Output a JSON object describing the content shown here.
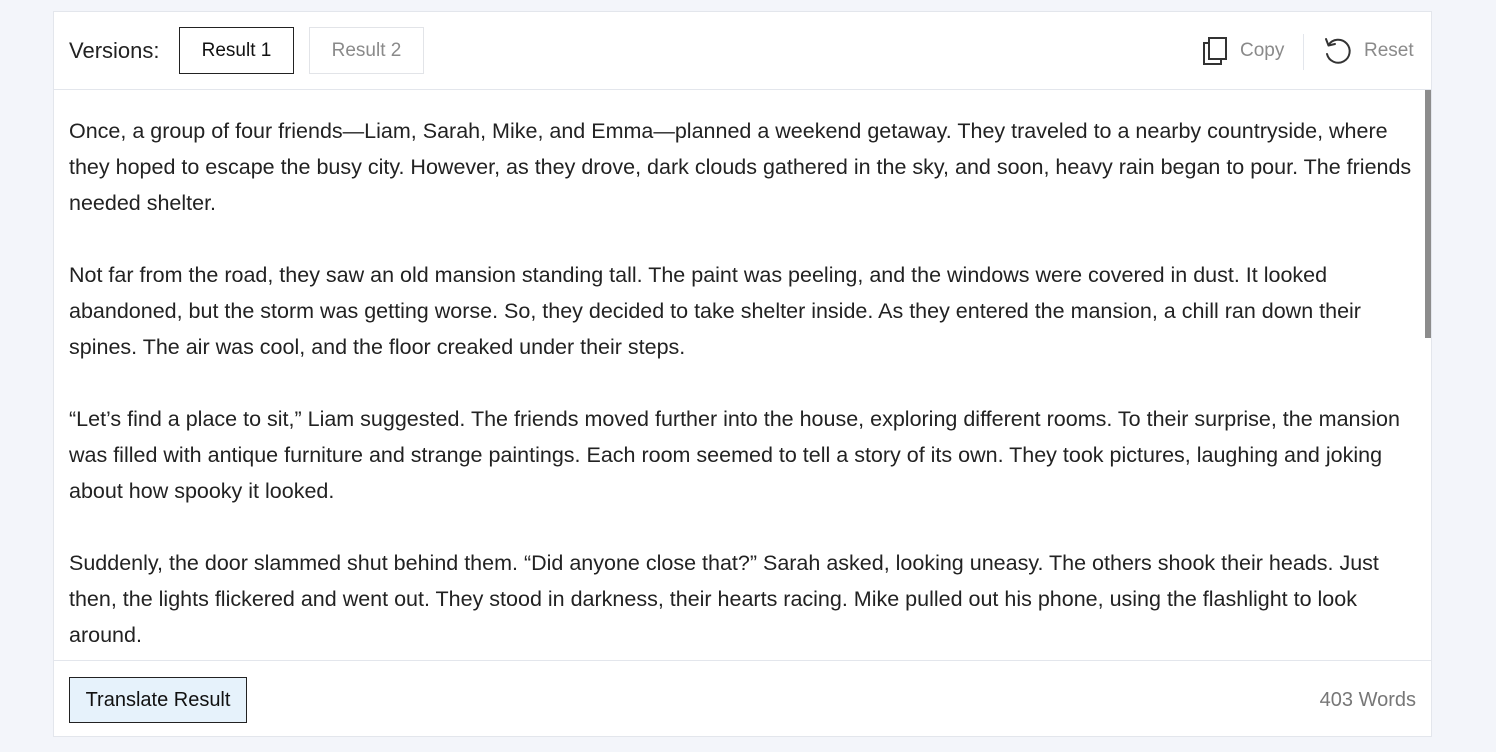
{
  "toolbar": {
    "versions_label": "Versions:",
    "tabs": [
      {
        "label": "Result 1",
        "active": true
      },
      {
        "label": "Result 2",
        "active": false
      }
    ],
    "copy_label": "Copy",
    "copy_icon": "copy-icon",
    "reset_label": "Reset",
    "reset_icon": "reset-icon"
  },
  "content": {
    "paragraphs": [
      "Once, a group of four friends—Liam, Sarah, Mike, and Emma—planned a weekend getaway. They traveled to a nearby countryside, where they hoped to escape the busy city. However, as they drove, dark clouds gathered in the sky, and soon, heavy rain began to pour. The friends needed shelter.",
      "Not far from the road, they saw an old mansion standing tall. The paint was peeling, and the windows were covered in dust. It looked abandoned, but the storm was getting worse. So, they decided to take shelter inside. As they entered the mansion, a chill ran down their spines. The air was cool, and the floor creaked under their steps.",
      "“Let’s find a place to sit,” Liam suggested. The friends moved further into the house, exploring different rooms. To their surprise, the mansion was filled with antique furniture and strange paintings. Each room seemed to tell a story of its own. They took pictures, laughing and joking about how spooky it looked.",
      "Suddenly, the door slammed shut behind them. “Did anyone close that?” Sarah asked, looking uneasy. The others shook their heads. Just then, the lights flickered and went out. They stood in darkness, their hearts racing. Mike pulled out his phone, using the flashlight to look around."
    ]
  },
  "footer": {
    "translate_label": "Translate Result",
    "word_count": "403 Words"
  },
  "colors": {
    "page_bg": "#f3f5fa",
    "translate_bg": "#e6f2fb",
    "muted_text": "#8a8a8a"
  }
}
